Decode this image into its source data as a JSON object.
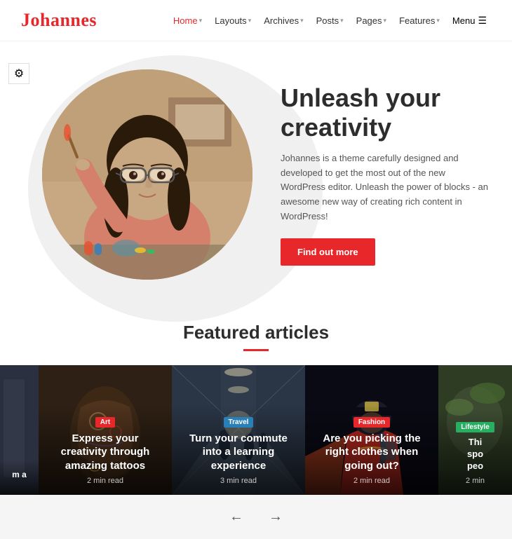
{
  "header": {
    "logo": "Johannes",
    "nav": [
      {
        "label": "Home",
        "active": true,
        "has_dropdown": true
      },
      {
        "label": "Layouts",
        "active": false,
        "has_dropdown": true
      },
      {
        "label": "Archives",
        "active": false,
        "has_dropdown": true
      },
      {
        "label": "Posts",
        "active": false,
        "has_dropdown": true
      },
      {
        "label": "Pages",
        "active": false,
        "has_dropdown": true
      },
      {
        "label": "Features",
        "active": false,
        "has_dropdown": true
      }
    ],
    "menu_label": "Menu"
  },
  "hero": {
    "title": "Unleash your creativity",
    "description": "Johannes is a theme carefully designed and developed to get the most out of the new WordPress editor. Unleash the power of blocks - an awesome new way of creating rich content in WordPress!",
    "cta_label": "Find out more"
  },
  "featured": {
    "title": "Featured articles",
    "divider_color": "#e8272a"
  },
  "cards": [
    {
      "tag": "Art",
      "tag_class": "art",
      "title": "Express your creativity through amazing tattoos",
      "read_time": "2 min read",
      "photo_class": "photo-tattoo",
      "size": "full"
    },
    {
      "tag": "Travel",
      "tag_class": "travel",
      "title": "Turn your commute into a learning experience",
      "read_time": "3 min read",
      "photo_class": "photo-commute",
      "size": "full"
    },
    {
      "tag": "Fashion",
      "tag_class": "fashion",
      "title": "Are you picking the right clothes when going out?",
      "read_time": "2 min read",
      "photo_class": "photo-fashion",
      "size": "full"
    },
    {
      "tag": "Lifestyle",
      "tag_class": "lifestyle",
      "title": "This spo peo",
      "read_time": "2 min",
      "photo_class": "photo-right-partial",
      "size": "partial"
    }
  ],
  "carousel": {
    "prev_label": "←",
    "next_label": "→"
  },
  "settings": {
    "icon": "⚙"
  }
}
